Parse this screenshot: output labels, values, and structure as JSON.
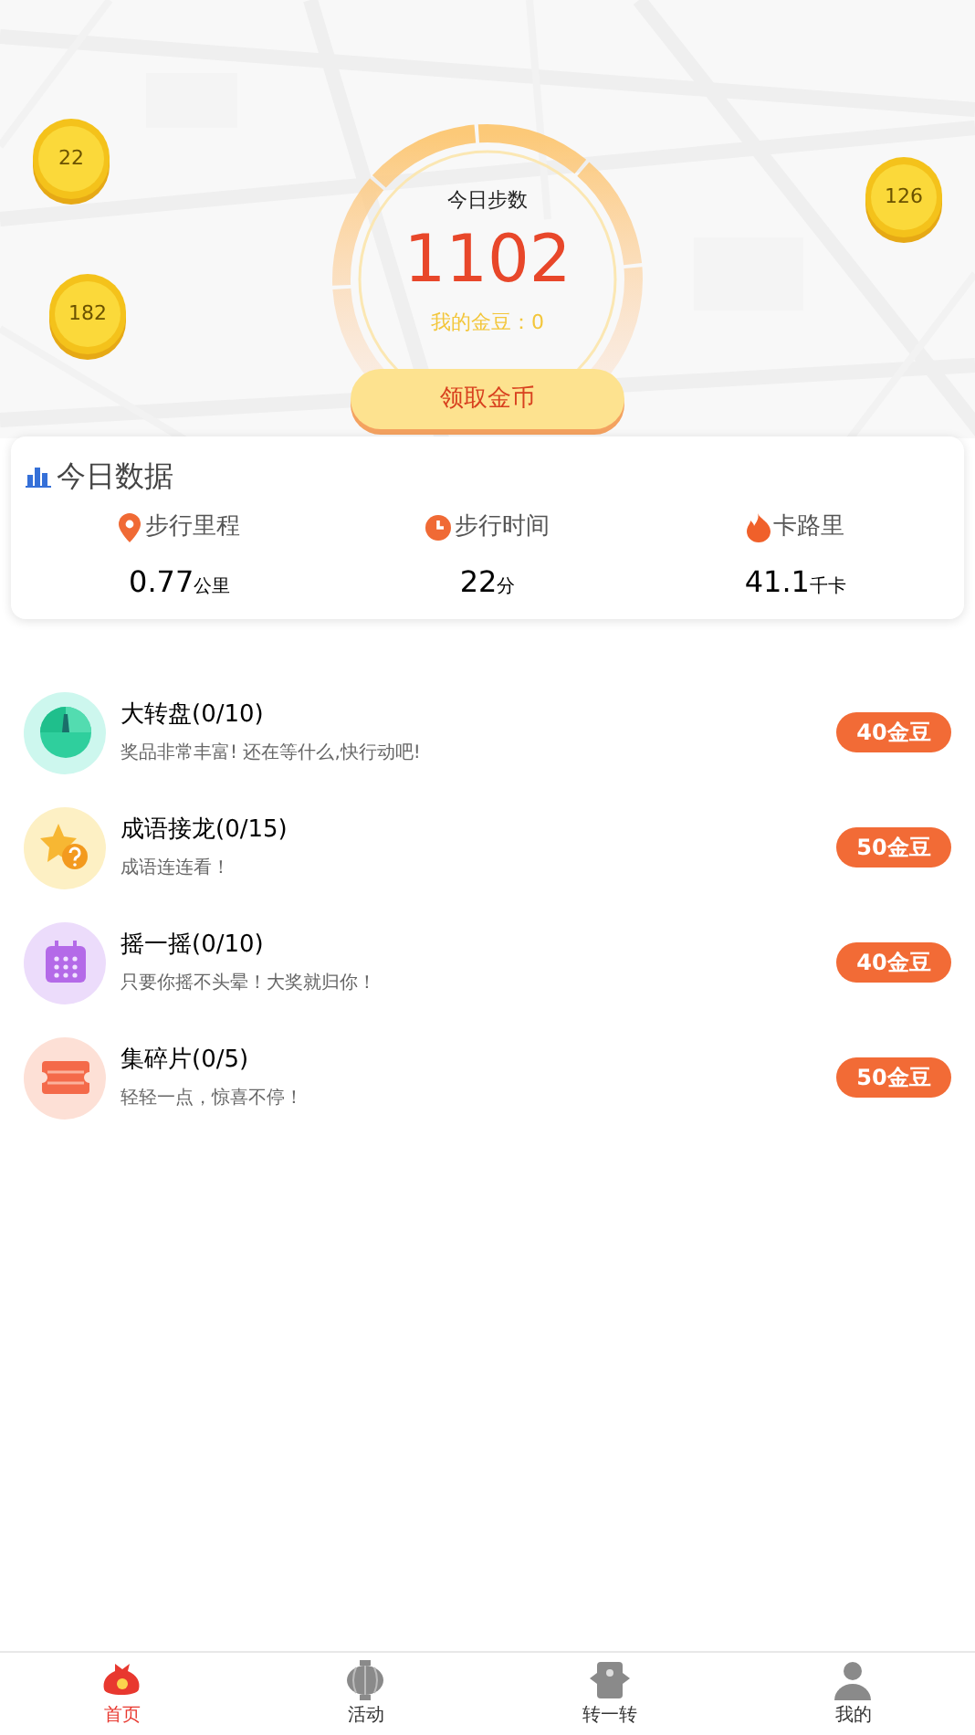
{
  "coins": [
    {
      "value": "22"
    },
    {
      "value": "182"
    },
    {
      "value": "126"
    }
  ],
  "gauge": {
    "title": "今日步数",
    "steps": "1102",
    "beans_label": "我的金豆：0",
    "button": "领取金币"
  },
  "today": {
    "title": "今日数据",
    "stats": [
      {
        "kind": "pin",
        "label": "步行里程",
        "value": "0.77",
        "unit": "公里"
      },
      {
        "kind": "clock",
        "label": "步行时间",
        "value": "22",
        "unit": "分"
      },
      {
        "kind": "fire",
        "label": "卡路里",
        "value": "41.1",
        "unit": "千卡"
      }
    ]
  },
  "tasks": [
    {
      "kind": "wheel",
      "title": "大转盘(0/10)",
      "subtitle": "奖品非常丰富! 还在等什么,快行动吧!",
      "reward": "40金豆"
    },
    {
      "kind": "star",
      "title": "成语接龙(0/15)",
      "subtitle": "成语连连看！",
      "reward": "50金豆"
    },
    {
      "kind": "calendar",
      "title": "摇一摇(0/10)",
      "subtitle": "只要你摇不头晕！大奖就归你！",
      "reward": "40金豆"
    },
    {
      "kind": "ticket",
      "title": "集碎片(0/5)",
      "subtitle": "轻轻一点，惊喜不停！",
      "reward": "50金豆"
    }
  ],
  "nav": [
    {
      "kind": "bag",
      "label": "首页",
      "selected": true
    },
    {
      "kind": "lantern",
      "label": "活动",
      "selected": false
    },
    {
      "kind": "box",
      "label": "转一转",
      "selected": false
    },
    {
      "kind": "user",
      "label": "我的",
      "selected": false
    }
  ]
}
